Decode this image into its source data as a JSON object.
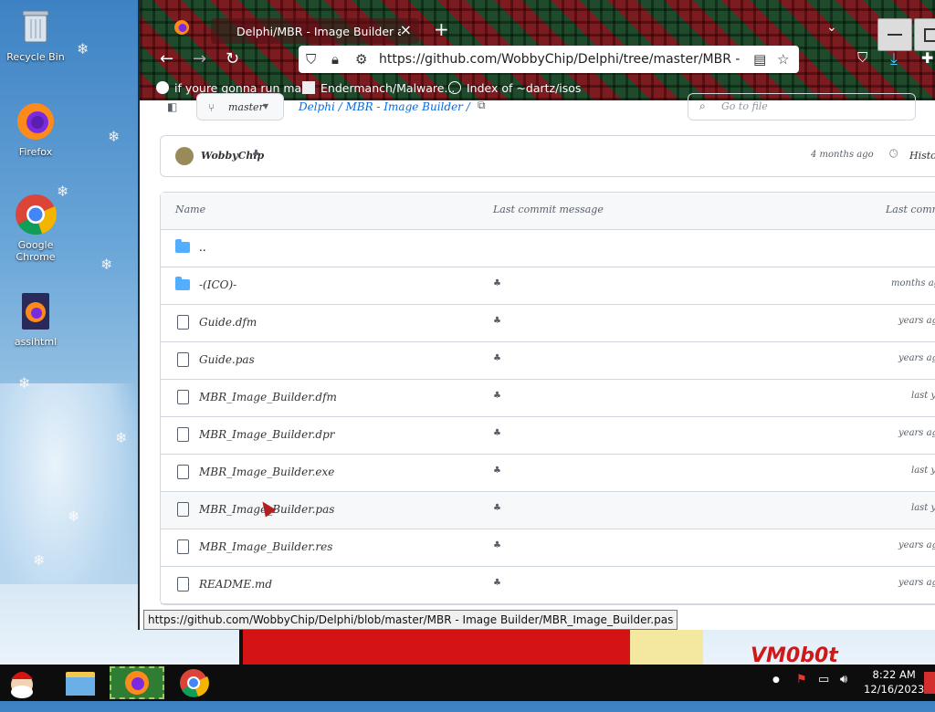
{
  "desktop": {
    "icons": [
      {
        "label": "Recycle Bin"
      },
      {
        "label": "Firefox"
      },
      {
        "label": "Google Chrome"
      },
      {
        "label": "assihtml"
      }
    ],
    "watermark": "VM0b0t"
  },
  "browser": {
    "tab": {
      "title": "Delphi/MBR - Image Builder at master"
    },
    "url": "https://github.com/WobbyChip/Delphi/tree/master/MBR - Image Builder",
    "bookmarks": [
      {
        "label": "if youre gonna run ma..."
      },
      {
        "label": "Endermanch/Malware..."
      },
      {
        "label": "Index of ~dartz/isos"
      }
    ]
  },
  "repo": {
    "branch": "master",
    "breadcrumb": "Delphi / MBR - Image Builder /",
    "search_placeholder": "Go to file",
    "commit_author": "WobbyChip",
    "commit_meta": "4 months ago",
    "history_label": "History",
    "table": {
      "headers": [
        "Name",
        "Last commit message",
        "Last commit date"
      ],
      "rows": [
        {
          "name": "..",
          "type": "folder",
          "msg": "",
          "date": ""
        },
        {
          "name": "-(ICO)-",
          "type": "folder",
          "msg": "♣",
          "date": "months ago"
        },
        {
          "name": "Guide.dfm",
          "type": "file",
          "msg": "♣",
          "date": "years ago"
        },
        {
          "name": "Guide.pas",
          "type": "file",
          "msg": "♣",
          "date": "years ago"
        },
        {
          "name": "MBR_Image_Builder.dfm",
          "type": "file",
          "msg": "♣",
          "date": "last year"
        },
        {
          "name": "MBR_Image_Builder.dpr",
          "type": "file",
          "msg": "♣",
          "date": "years ago"
        },
        {
          "name": "MBR_Image_Builder.exe",
          "type": "file",
          "msg": "♣",
          "date": "last year"
        },
        {
          "name": "MBR_Image_Builder.pas",
          "type": "file",
          "msg": "♣",
          "date": "last year"
        },
        {
          "name": "MBR_Image_Builder.res",
          "type": "file",
          "msg": "♣",
          "date": "years ago"
        },
        {
          "name": "README.md",
          "type": "file",
          "msg": "♣",
          "date": "years ago"
        }
      ]
    }
  },
  "status_tooltip": "https://github.com/WobbyChip/Delphi/blob/master/MBR - Image Builder/MBR_Image_Builder.pas",
  "taskbar": {
    "time": "8:22 AM",
    "date": "12/16/2023"
  }
}
